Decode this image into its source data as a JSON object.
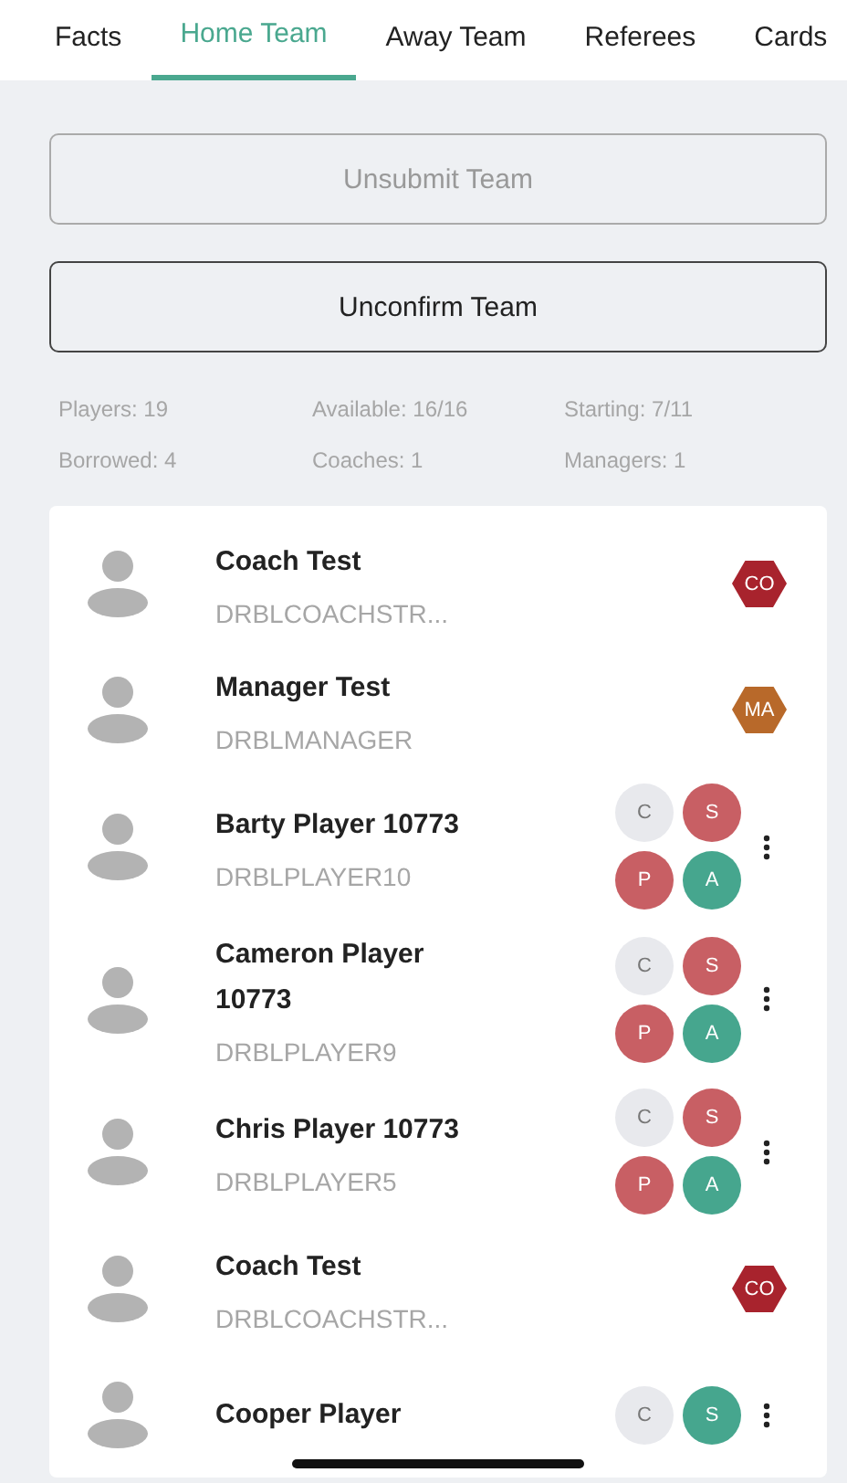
{
  "tabs": [
    {
      "label": "Facts",
      "selected": false
    },
    {
      "label": "Home Team",
      "selected": true
    },
    {
      "label": "Away Team",
      "selected": false
    },
    {
      "label": "Referees",
      "selected": false
    },
    {
      "label": "Cards",
      "selected": false
    }
  ],
  "actions": [
    {
      "label": "Unsubmit Team",
      "disabled": true
    },
    {
      "label": "Unconfirm Team",
      "disabled": false
    }
  ],
  "stats": [
    "Players: 19",
    "Available: 16/16",
    "Starting: 7/11",
    "Borrowed: 4",
    "Coaches: 1",
    "Managers: 1"
  ],
  "members": [
    {
      "kind": "staff",
      "name": "Coach Test",
      "code": "DRBLCOACHSTR...",
      "badges": [
        {
          "label": "CO",
          "color": "#a8232d"
        }
      ]
    },
    {
      "kind": "staff",
      "name": "Manager Test",
      "code": "DRBLMANAGER",
      "badges": [
        {
          "label": "MA",
          "color": "#b8692a"
        }
      ]
    },
    {
      "kind": "player",
      "name": "Barty Player 10773",
      "code": "DRBLPLAYER10",
      "badges": [
        {
          "label": "C",
          "color": "#e8e9ed"
        },
        {
          "label": "S",
          "color": "#c85f64"
        },
        {
          "label": "P",
          "color": "#c85f64"
        },
        {
          "label": "A",
          "color": "#46a68e"
        }
      ]
    },
    {
      "kind": "player",
      "name": "Cameron Player 10773",
      "code": "DRBLPLAYER9",
      "badges": [
        {
          "label": "C",
          "color": "#e8e9ed"
        },
        {
          "label": "S",
          "color": "#c85f64"
        },
        {
          "label": "P",
          "color": "#c85f64"
        },
        {
          "label": "A",
          "color": "#46a68e"
        }
      ]
    },
    {
      "kind": "player",
      "name": "Chris Player 10773",
      "code": "DRBLPLAYER5",
      "badges": [
        {
          "label": "C",
          "color": "#e8e9ed"
        },
        {
          "label": "S",
          "color": "#c85f64"
        },
        {
          "label": "P",
          "color": "#c85f64"
        },
        {
          "label": "A",
          "color": "#46a68e"
        }
      ]
    },
    {
      "kind": "staff",
      "name": "Coach Test",
      "code": "DRBLCOACHSTR...",
      "badges": [
        {
          "label": "CO",
          "color": "#a8232d"
        }
      ]
    },
    {
      "kind": "player",
      "name": "Cooper Player",
      "badges": [
        {
          "label": "C",
          "color": "#e8e9ed"
        },
        {
          "label": "S",
          "color": "#46a68e"
        }
      ]
    }
  ]
}
